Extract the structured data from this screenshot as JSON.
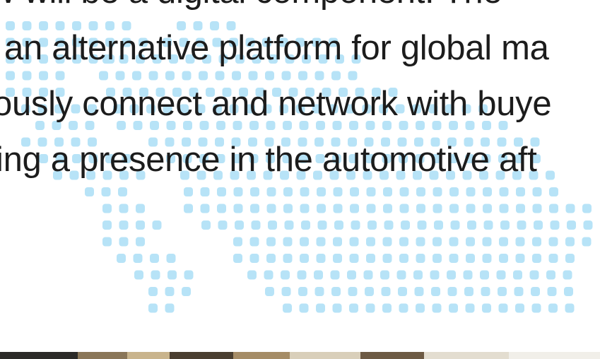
{
  "body_text": {
    "lines": [
      "w will be a digital component. The",
      "an alternative platform for global ma",
      "ously connect and network with buye",
      "ing a presence in the automotive aft"
    ]
  },
  "colors": {
    "dot_color": "#b7e3f7",
    "text_color": "#1c1c1c",
    "background": "#ffffff"
  },
  "decorations": {
    "map_icon": "dotted-world-map",
    "photo_strip": "photo-edge"
  }
}
